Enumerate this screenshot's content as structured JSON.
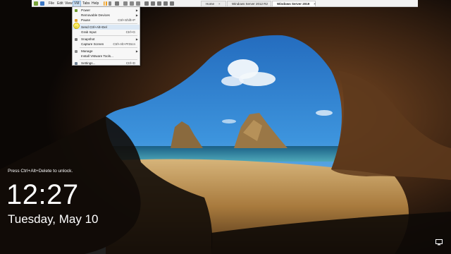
{
  "vmware": {
    "menu": [
      "File",
      "Edit",
      "View",
      "VM",
      "Tabs",
      "Help"
    ],
    "active_menu": "VM",
    "tabs": [
      {
        "label": "Home",
        "active": false
      },
      {
        "label": "Windows Server 2012 R2",
        "active": false
      },
      {
        "label": "Windows Server 2019",
        "active": true
      }
    ]
  },
  "vm_menu": {
    "items": [
      {
        "label": "Power",
        "shortcut": "",
        "submenu": true,
        "icon": "power-icon"
      },
      {
        "label": "Removable Devices",
        "shortcut": "",
        "submenu": true,
        "icon": ""
      },
      {
        "label": "Pause",
        "shortcut": "Ctrl+Shift+P",
        "submenu": false,
        "icon": "pause-icon"
      },
      {
        "label": "Send Ctrl+Alt+Del",
        "shortcut": "",
        "submenu": false,
        "icon": "keyboard-icon"
      },
      {
        "label": "Grab Input",
        "shortcut": "Ctrl+G",
        "submenu": false,
        "icon": ""
      },
      {
        "label": "Snapshot",
        "shortcut": "",
        "submenu": true,
        "icon": "snapshot-icon"
      },
      {
        "label": "Capture Screen",
        "shortcut": "Ctrl+Alt+PrtScn",
        "submenu": false,
        "icon": ""
      },
      {
        "label": "Manage",
        "shortcut": "",
        "submenu": true,
        "icon": "manage-icon"
      },
      {
        "label": "Install VMware Tools...",
        "shortcut": "",
        "submenu": false,
        "icon": ""
      },
      {
        "label": "Settings...",
        "shortcut": "Ctrl+D",
        "submenu": false,
        "icon": "settings-icon"
      }
    ],
    "highlighted": "Send Ctrl+Alt+Del"
  },
  "lock_screen": {
    "hint": "Press Ctrl+Alt+Delete to unlock.",
    "time": "12:27",
    "date": "Tuesday, May 10"
  },
  "colors": {
    "sky": "#2f86d6",
    "sea": "#1f6f95",
    "sand": "#b88b4a",
    "rock": "#3a2414",
    "menu_highlight": "#dbe8f5",
    "cursor": "#ffec46"
  }
}
